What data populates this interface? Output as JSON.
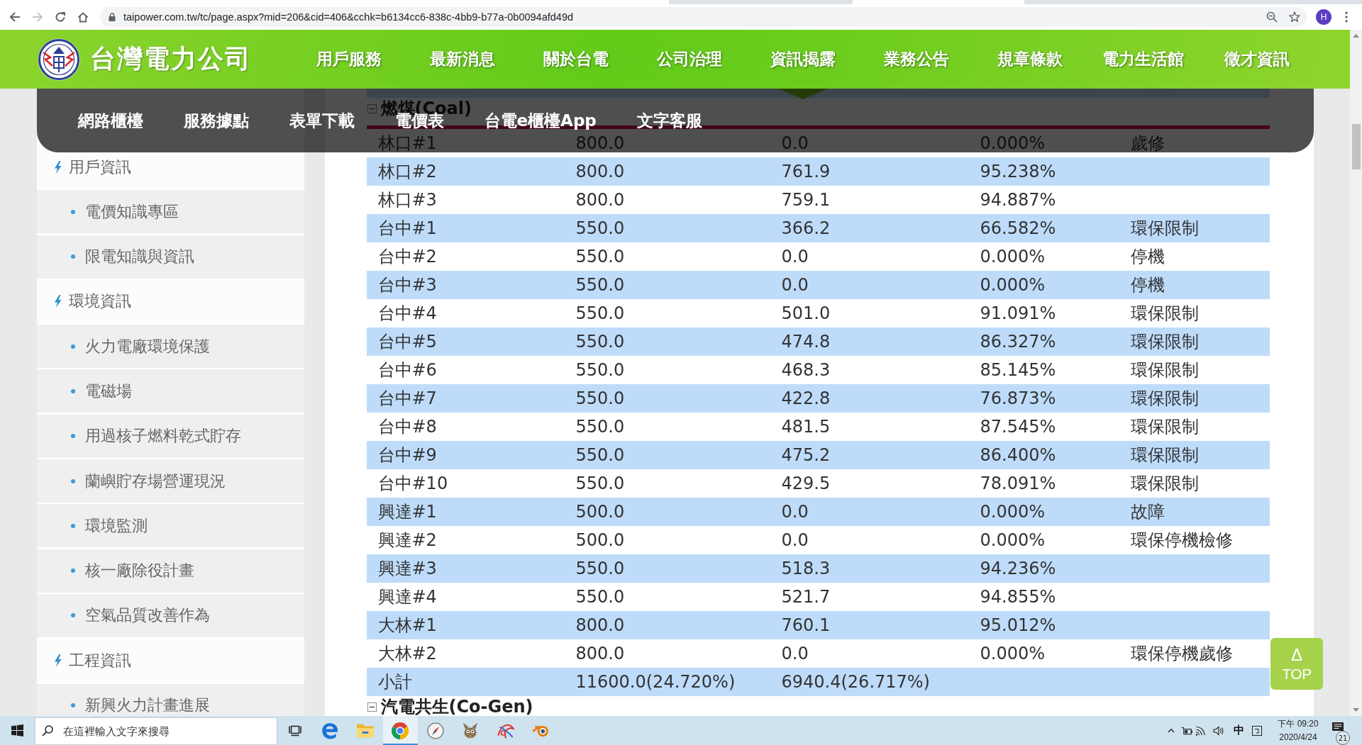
{
  "browser": {
    "nav_buttons": [
      {
        "kind": "back",
        "disabled": false
      },
      {
        "kind": "forward",
        "disabled": true
      },
      {
        "kind": "reload",
        "disabled": false
      },
      {
        "kind": "home",
        "disabled": false
      }
    ],
    "url": "taipower.com.tw/tc/page.aspx?mid=206&cid=406&cchk=b6134cc6-838c-4bb9-b77a-0b0094afd49d",
    "profile": "H"
  },
  "header": {
    "title": "台灣電力公司",
    "nav": [
      {
        "label": "用戶服務",
        "selected": false
      },
      {
        "label": "最新消息",
        "selected": false
      },
      {
        "label": "關於台電",
        "selected": false
      },
      {
        "label": "公司治理",
        "selected": false
      },
      {
        "label": "資訊揭露",
        "selected": true
      },
      {
        "label": "業務公告",
        "selected": false
      },
      {
        "label": "規章條款",
        "selected": false
      },
      {
        "label": "電力生活館",
        "selected": false
      },
      {
        "label": "徵才資訊",
        "selected": false
      }
    ]
  },
  "dropdown": {
    "items": [
      "網路櫃檯",
      "服務據點",
      "表單下載",
      "電價表",
      "台電e櫃檯App",
      "文字客服"
    ]
  },
  "sidebar": {
    "items": [
      {
        "kind": "category",
        "label": "用戶資訊"
      },
      {
        "kind": "link",
        "label": "電價知識專區"
      },
      {
        "kind": "link",
        "label": "限電知識與資訊"
      },
      {
        "kind": "category",
        "label": "環境資訊"
      },
      {
        "kind": "link",
        "label": "火力電廠環境保護"
      },
      {
        "kind": "link",
        "label": "電磁場"
      },
      {
        "kind": "link",
        "label": "用過核子燃料乾式貯存"
      },
      {
        "kind": "link",
        "label": "蘭嶼貯存場營運現況"
      },
      {
        "kind": "link",
        "label": "環境監測"
      },
      {
        "kind": "link",
        "label": "核一廠除役計畫"
      },
      {
        "kind": "link",
        "label": "空氣品質改善作為"
      },
      {
        "kind": "category",
        "label": "工程資訊"
      },
      {
        "kind": "link",
        "label": "新興火力計畫進展"
      }
    ]
  },
  "sections": [
    {
      "title": "燃煤(Coal)",
      "expanded": true,
      "rows": [
        {
          "cells": [
            "林口#1",
            "800.0",
            "0.0",
            "0.000%",
            "歲修"
          ]
        },
        {
          "cells": [
            "林口#2",
            "800.0",
            "761.9",
            "95.238%"
          ]
        },
        {
          "cells": [
            "林口#3",
            "800.0",
            "759.1",
            "94.887%"
          ]
        },
        {
          "cells": [
            "台中#1",
            "550.0",
            "366.2",
            "66.582%",
            "環保限制"
          ]
        },
        {
          "cells": [
            "台中#2",
            "550.0",
            "0.0",
            "0.000%",
            "停機"
          ]
        },
        {
          "cells": [
            "台中#3",
            "550.0",
            "0.0",
            "0.000%",
            "停機"
          ]
        },
        {
          "cells": [
            "台中#4",
            "550.0",
            "501.0",
            "91.091%",
            "環保限制"
          ]
        },
        {
          "cells": [
            "台中#5",
            "550.0",
            "474.8",
            "86.327%",
            "環保限制"
          ]
        },
        {
          "cells": [
            "台中#6",
            "550.0",
            "468.3",
            "85.145%",
            "環保限制"
          ]
        },
        {
          "cells": [
            "台中#7",
            "550.0",
            "422.8",
            "76.873%",
            "環保限制"
          ]
        },
        {
          "cells": [
            "台中#8",
            "550.0",
            "481.5",
            "87.545%",
            "環保限制"
          ]
        },
        {
          "cells": [
            "台中#9",
            "550.0",
            "475.2",
            "86.400%",
            "環保限制"
          ]
        },
        {
          "cells": [
            "台中#10",
            "550.0",
            "429.5",
            "78.091%",
            "環保限制"
          ]
        },
        {
          "cells": [
            "興達#1",
            "500.0",
            "0.0",
            "0.000%",
            "故障"
          ]
        },
        {
          "cells": [
            "興達#2",
            "500.0",
            "0.0",
            "0.000%",
            "環保停機檢修"
          ]
        },
        {
          "cells": [
            "興達#3",
            "550.0",
            "518.3",
            "94.236%"
          ]
        },
        {
          "cells": [
            "興達#4",
            "550.0",
            "521.7",
            "94.855%"
          ]
        },
        {
          "cells": [
            "大林#1",
            "800.0",
            "760.1",
            "95.012%"
          ]
        },
        {
          "cells": [
            "大林#2",
            "800.0",
            "0.0",
            "0.000%",
            "環保停機歲修"
          ]
        },
        {
          "cells": [
            "小計",
            "11600.0(24.720%)",
            "6940.4(26.717%)"
          ]
        }
      ]
    },
    {
      "title": "汽電共生(Co-Gen)",
      "expanded": true
    }
  ],
  "back_to_top": {
    "arrow": "Δ",
    "label": "TOP"
  },
  "taskbar": {
    "search": {
      "placeholder": "在這裡輸入文字來搜尋"
    },
    "apps": [
      {
        "kind": "taskview",
        "selected": false
      },
      {
        "kind": "e-logo",
        "selected": false
      },
      {
        "kind": "folder",
        "selected": false
      },
      {
        "kind": "ring",
        "selected": true
      },
      {
        "kind": "compass",
        "selected": false
      },
      {
        "kind": "mascot",
        "selected": false
      },
      {
        "kind": "doodle",
        "selected": false
      },
      {
        "kind": "orbit",
        "selected": false
      }
    ],
    "tray": {
      "ime": "中",
      "time": "下午 09:20",
      "date": "2020/4/24",
      "notifications": "21"
    }
  }
}
